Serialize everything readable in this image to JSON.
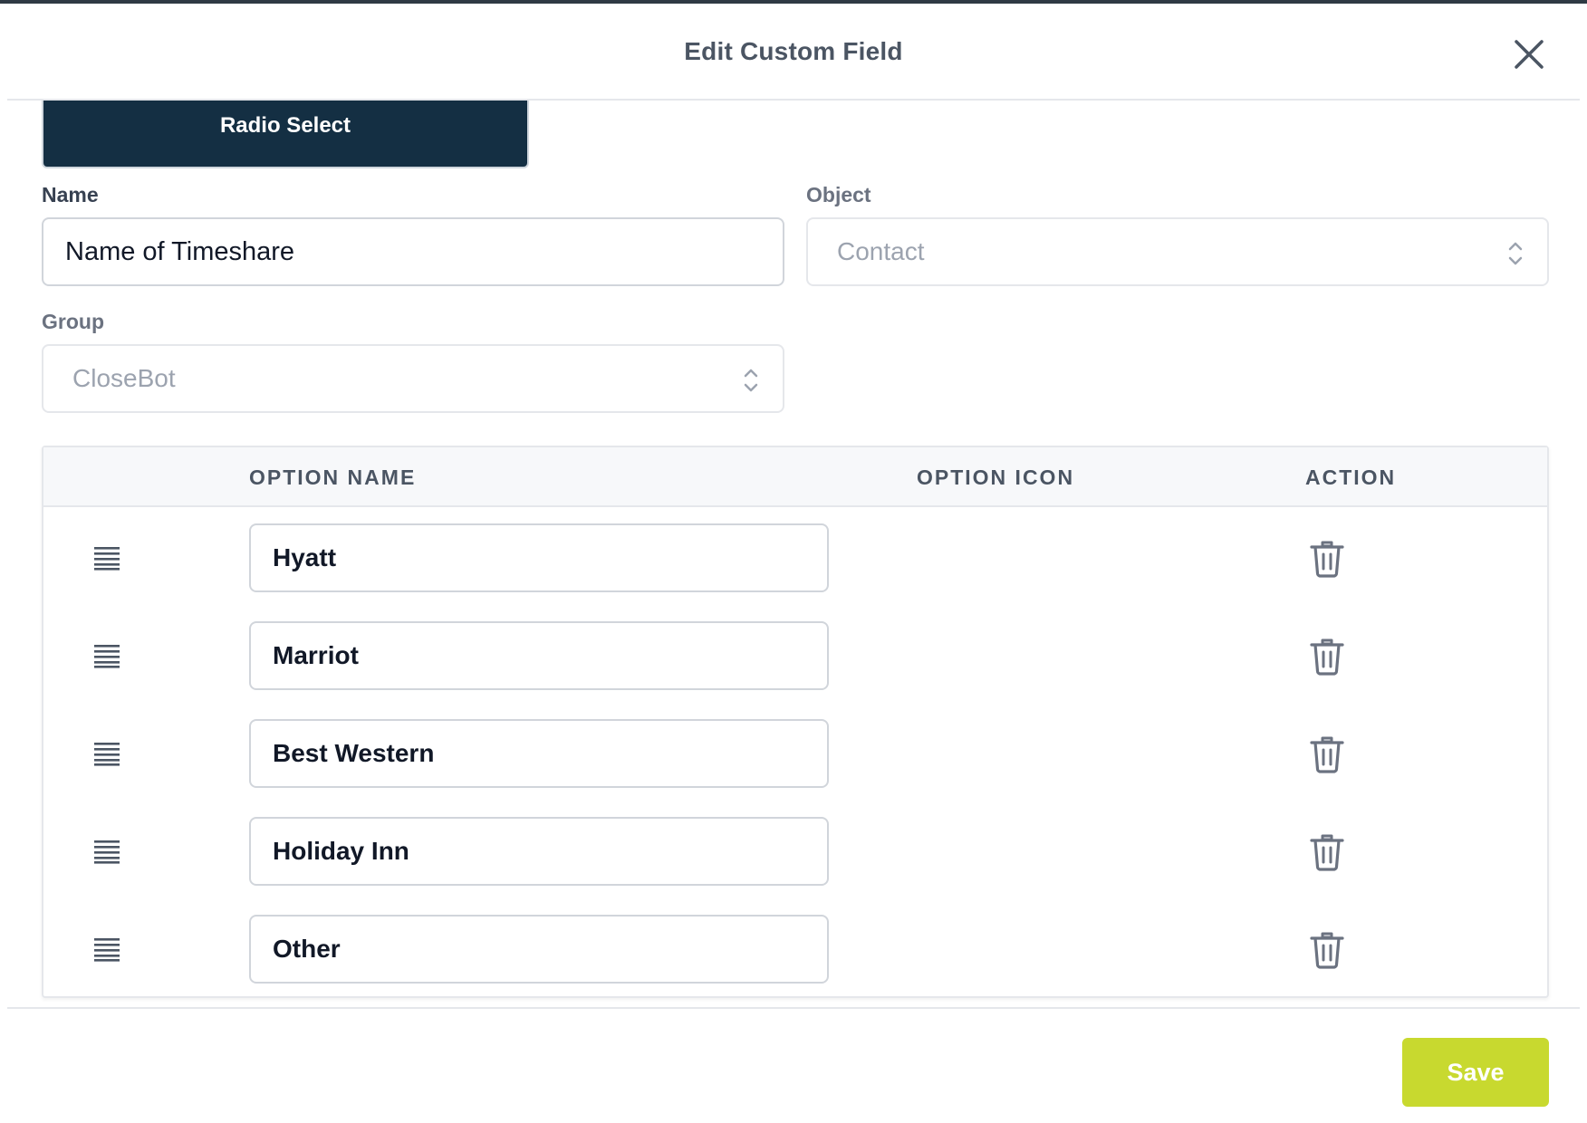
{
  "modal": {
    "title": "Edit Custom Field",
    "close_icon": "close-icon"
  },
  "field_type": {
    "label": "Radio Select"
  },
  "form": {
    "name": {
      "label": "Name",
      "value": "Name of Timeshare"
    },
    "object": {
      "label": "Object",
      "value": "Contact",
      "icon": "chevron-updown-icon"
    },
    "group": {
      "label": "Group",
      "value": "CloseBot",
      "icon": "chevron-updown-icon"
    }
  },
  "options_table": {
    "headers": {
      "name": "OPTION NAME",
      "icon": "OPTION ICON",
      "action": "ACTION"
    },
    "rows": [
      {
        "name": "Hyatt"
      },
      {
        "name": "Marriot"
      },
      {
        "name": "Best Western"
      },
      {
        "name": "Holiday Inn"
      },
      {
        "name": "Other"
      }
    ]
  },
  "footer": {
    "save_label": "Save"
  },
  "colors": {
    "chip_bg": "#142f43",
    "save_bg": "#c8d92f",
    "text_dark": "#111827",
    "text_muted": "#9ca3af"
  }
}
